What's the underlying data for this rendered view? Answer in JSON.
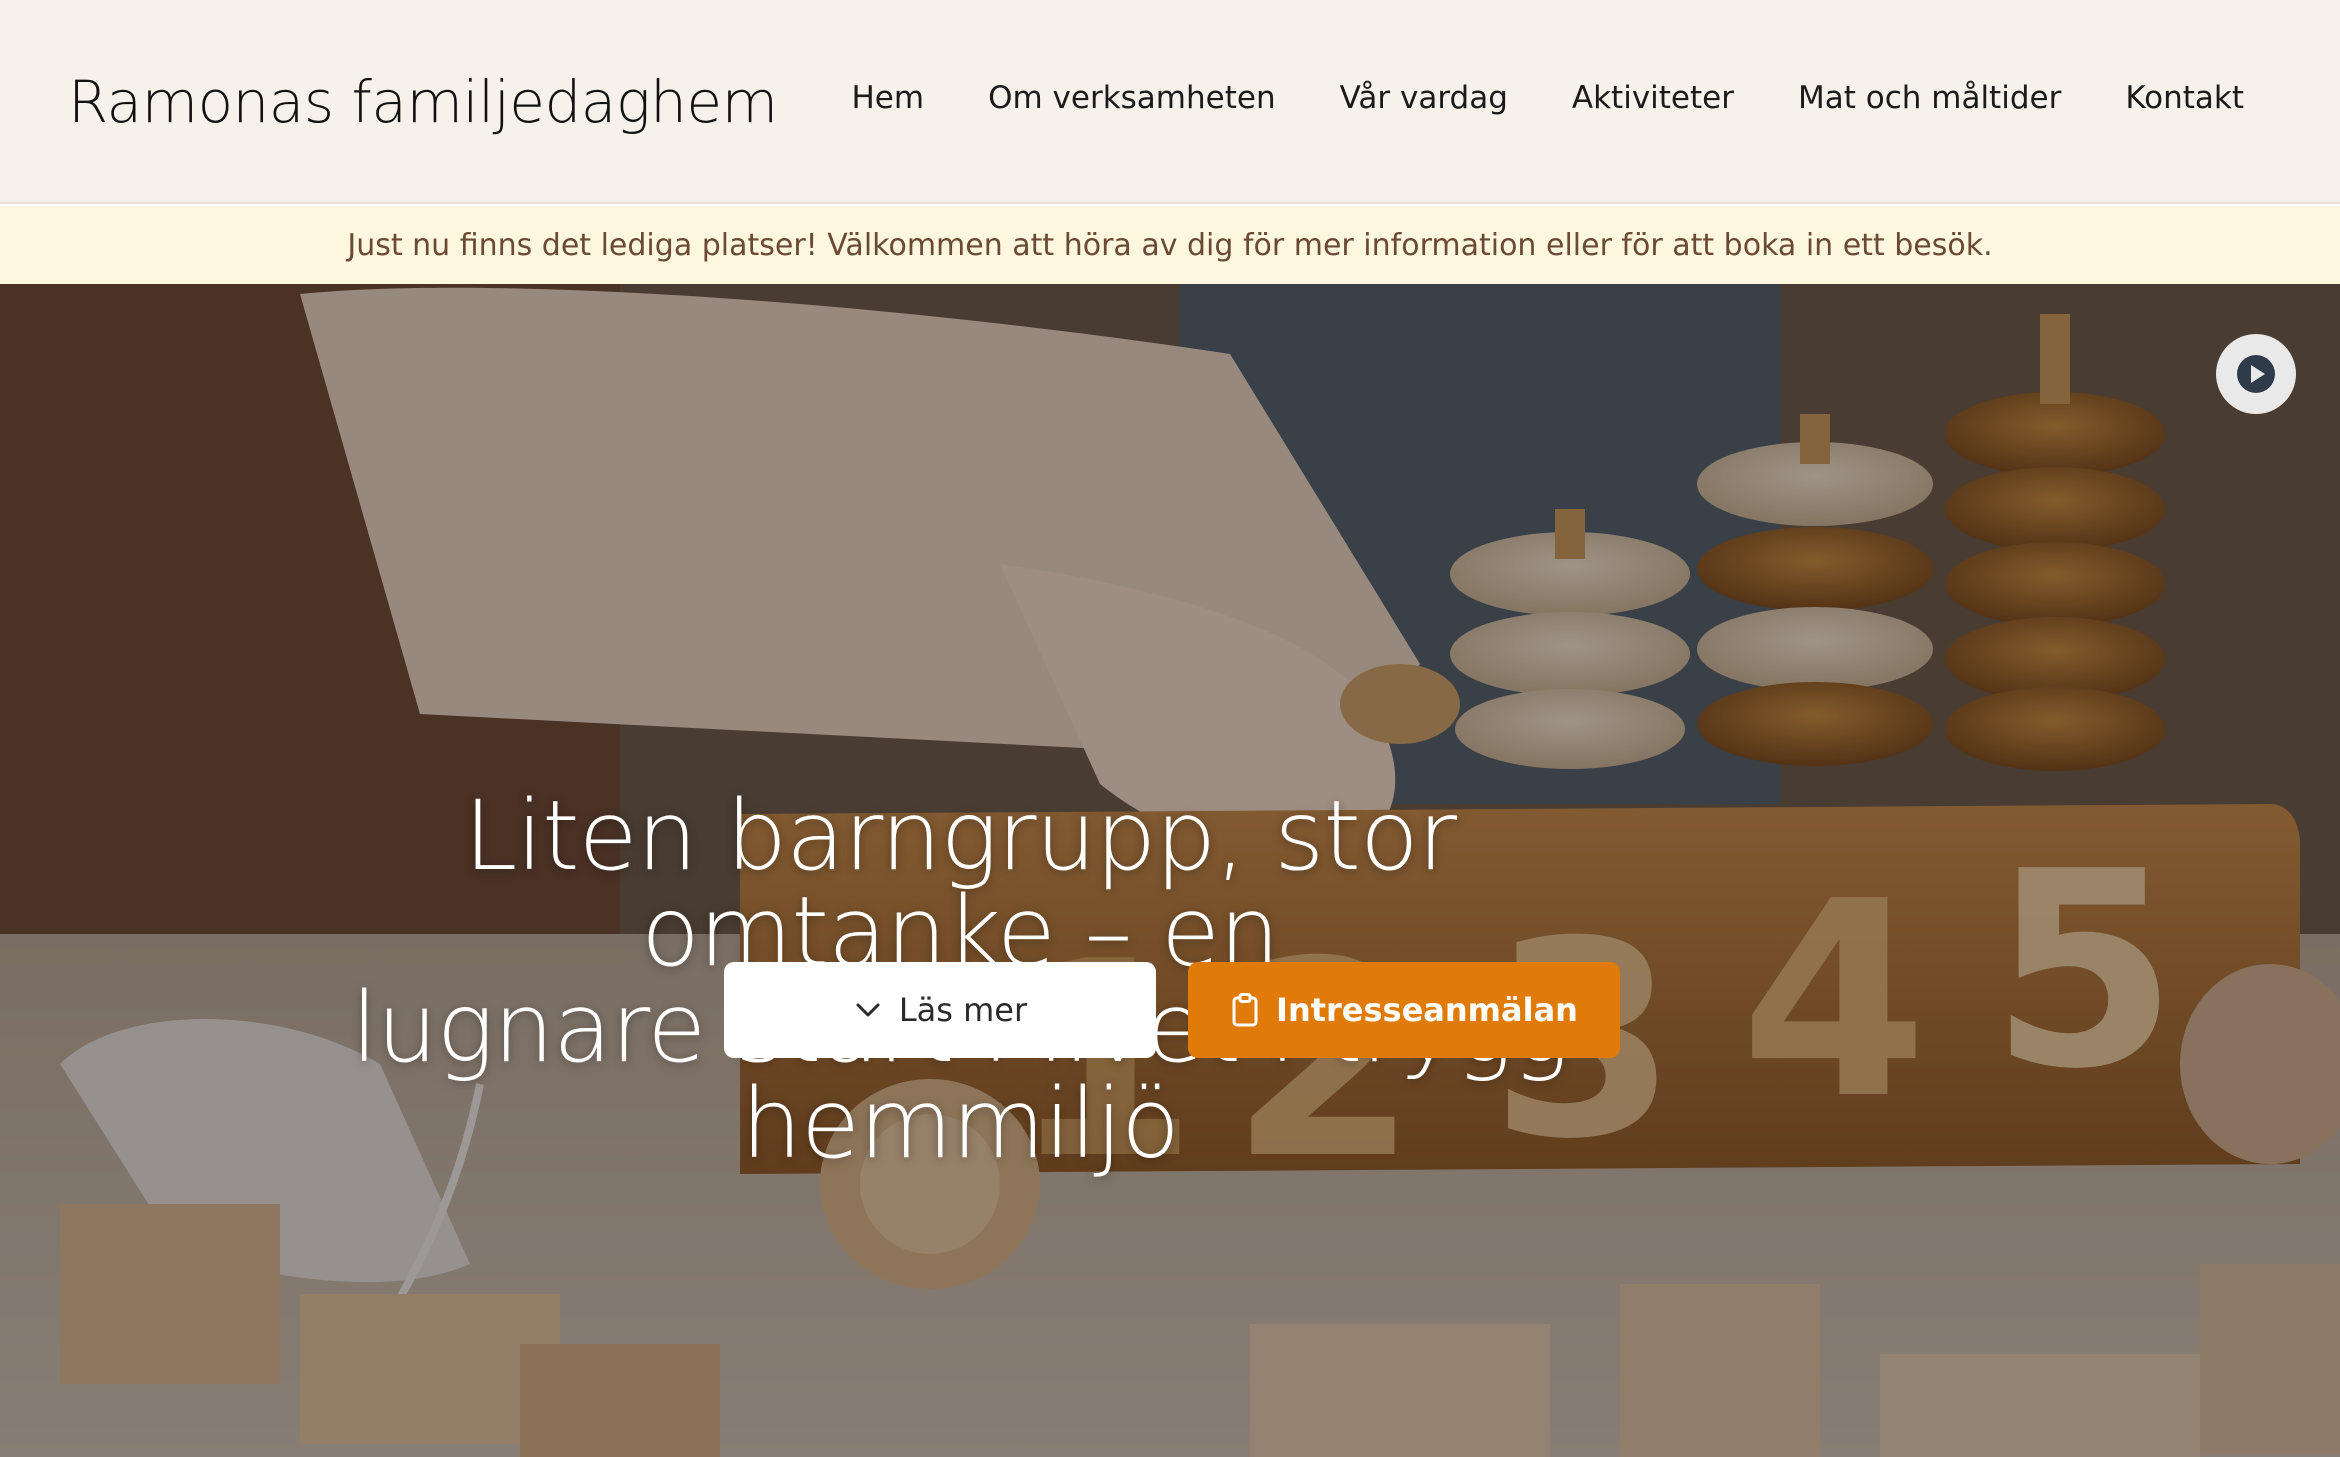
{
  "site": {
    "logo": "Ramonas familjedaghem"
  },
  "nav": {
    "items": [
      {
        "label": "Hem"
      },
      {
        "label": "Om verksamheten"
      },
      {
        "label": "Vår vardag"
      },
      {
        "label": "Aktiviteter"
      },
      {
        "label": "Mat och måltider"
      },
      {
        "label": "Kontakt"
      }
    ]
  },
  "banner": {
    "text": "Just nu finns det lediga platser! Välkommen att höra av dig för mer information eller för att boka in ett besök."
  },
  "hero": {
    "headline_line1": "Liten barngrupp, stor omtanke – en",
    "headline_line2": "lugnare start i livet i trygg hemmiljö",
    "read_more_label": "Läs mer",
    "interest_label": "Intresseanmälan",
    "numbers": [
      "1",
      "2",
      "3",
      "4",
      "5"
    ]
  },
  "colors": {
    "header_bg": "#f6f1eb",
    "banner_bg": "#fdf7e0",
    "banner_text": "#6b4a35",
    "accent": "#e07a09"
  },
  "icons": {
    "play": "play-circle-icon",
    "read_more": "chevron-down-icon",
    "interest": "clipboard-icon"
  }
}
